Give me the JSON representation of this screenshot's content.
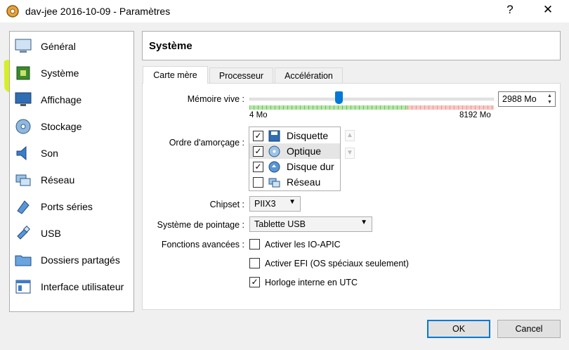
{
  "window": {
    "title": "dav-jee 2016-10-09 - Paramètres",
    "help_glyph": "?",
    "close_glyph": "✕"
  },
  "sidebar": {
    "items": [
      {
        "label": "Général",
        "icon": "monitor-icon"
      },
      {
        "label": "Système",
        "icon": "motherboard-icon"
      },
      {
        "label": "Affichage",
        "icon": "display-icon"
      },
      {
        "label": "Stockage",
        "icon": "disk-icon"
      },
      {
        "label": "Son",
        "icon": "speaker-icon"
      },
      {
        "label": "Réseau",
        "icon": "network-icon"
      },
      {
        "label": "Ports séries",
        "icon": "serial-port-icon"
      },
      {
        "label": "USB",
        "icon": "usb-icon"
      },
      {
        "label": "Dossiers partagés",
        "icon": "folder-icon"
      },
      {
        "label": "Interface utilisateur",
        "icon": "window-ui-icon"
      }
    ],
    "selected": "Système",
    "highlight_color": "#d4ef1a"
  },
  "section": {
    "title": "Système"
  },
  "tabs": [
    {
      "label": "Carte mère",
      "active": true
    },
    {
      "label": "Processeur",
      "active": false
    },
    {
      "label": "Accélération",
      "active": false
    }
  ],
  "motherboard": {
    "memory": {
      "label": "Mémoire vive :",
      "value_text": "2988 Mo",
      "value": 2988,
      "min_label": "4 Mo",
      "max_label": "8192 Mo",
      "min": 4,
      "max": 8192
    },
    "boot_order": {
      "label": "Ordre d'amorçage :",
      "items": [
        {
          "label": "Disquette",
          "checked": true,
          "icon": "floppy-icon"
        },
        {
          "label": "Optique",
          "checked": true,
          "icon": "optical-disc-icon"
        },
        {
          "label": "Disque dur",
          "checked": true,
          "icon": "hard-disk-icon"
        },
        {
          "label": "Réseau",
          "checked": false,
          "icon": "network-icon"
        }
      ]
    },
    "chipset": {
      "label": "Chipset :",
      "value": "PIIX3"
    },
    "pointing": {
      "label": "Système de pointage :",
      "value": "Tablette USB"
    },
    "advanced": {
      "label": "Fonctions avancées :",
      "options": [
        {
          "label": "Activer les IO-APIC",
          "checked": false
        },
        {
          "label": "Activer EFI (OS spéciaux seulement)",
          "checked": false
        },
        {
          "label": "Horloge interne en UTC",
          "checked": true
        }
      ]
    }
  },
  "buttons": {
    "ok": "OK",
    "cancel": "Cancel"
  },
  "colors": {
    "accent": "#0078d7",
    "selection": "#cce8ff"
  }
}
